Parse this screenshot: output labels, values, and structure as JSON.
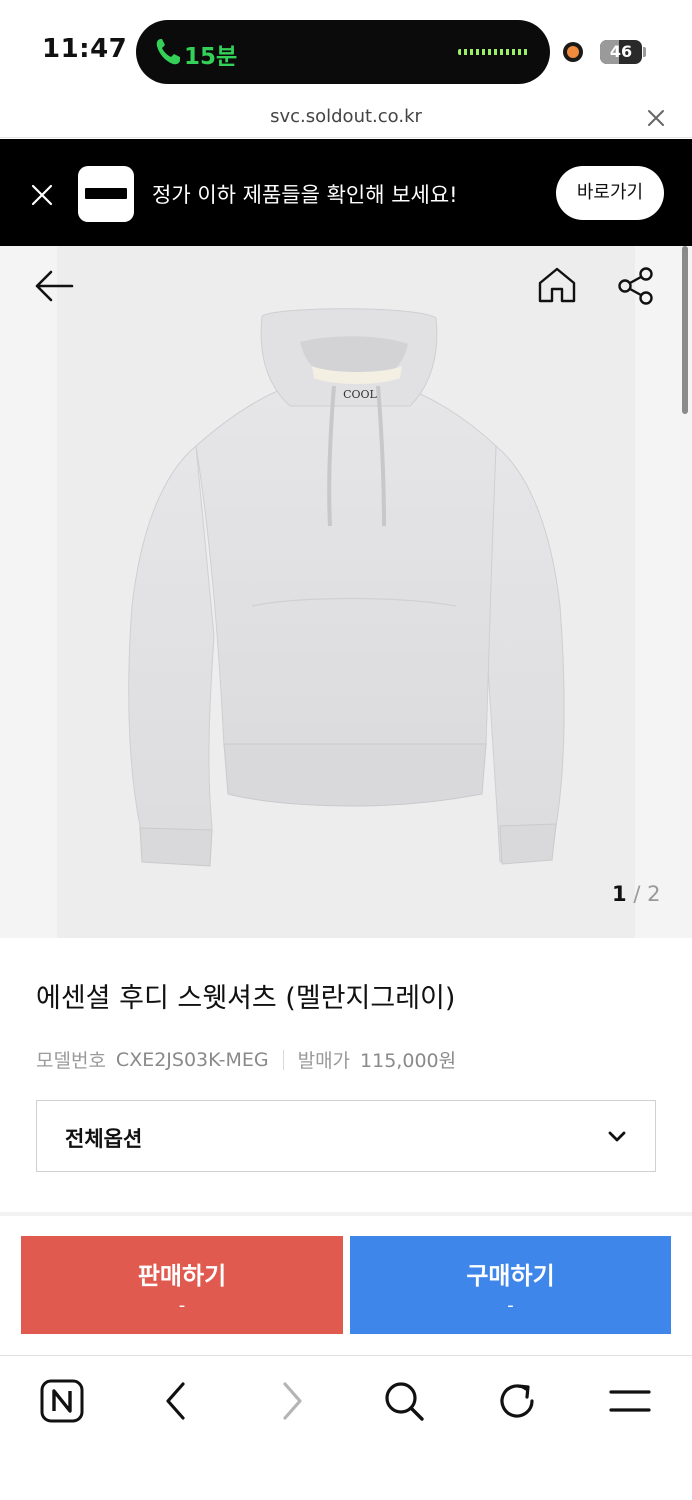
{
  "status_bar": {
    "time": "11:47",
    "call_duration": "15분",
    "battery": "46",
    "battery_level": 0.46,
    "call_color": "#34d058"
  },
  "browser": {
    "url": "svc.soldout.co.kr"
  },
  "banner": {
    "message": "정가 이하 제품들을 확인해 보세요!",
    "button_label": "바로가기"
  },
  "product": {
    "image_index": "1",
    "image_total": "2",
    "image_separator": "/",
    "logo_text": "COOL",
    "name": "에센셜 후디 스웻셔츠 (멜란지그레이)",
    "model_label": "모델번호",
    "model_number": "CXE2JS03K-MEG",
    "price_label": "발매가",
    "price": "115,000원"
  },
  "options": {
    "selected": "전체옵션"
  },
  "actions": {
    "sell_label": "판매하기",
    "sell_price": "-",
    "buy_label": "구매하기",
    "buy_price": "-",
    "sell_color": "#e05a50",
    "buy_color": "#3f86ea"
  },
  "icons": [
    "call-icon",
    "close-icon",
    "back-arrow-icon",
    "home-icon",
    "share-icon",
    "chevron-down-icon",
    "naver-icon",
    "browser-back-icon",
    "browser-forward-icon",
    "search-icon",
    "refresh-icon",
    "menu-icon"
  ]
}
